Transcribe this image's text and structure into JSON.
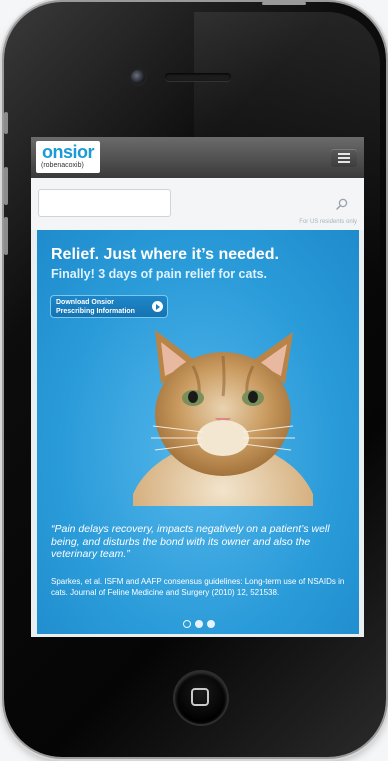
{
  "header": {
    "logo_word": "onsior",
    "logo_sub": "(robenacoxib)"
  },
  "search": {
    "value": "",
    "placeholder": "",
    "us_note": "For US residents only"
  },
  "hero": {
    "headline": "Relief. Just where it’s needed.",
    "subhead": "Finally! 3 days of pain relief for cats.",
    "download_line1": "Download Onsior",
    "download_line2": "Prescribing Information",
    "quote": "“Pain delays recovery, impacts negatively on a patient’s well being, and disturbs the bond with its owner and also the veterinary team.”",
    "citation": "Sparkes, et al. ISFM and AAFP consensus guidelines: Long-term use of NSAIDs in cats. Journal of Feline Medicine and Surgery (2010) 12, 521538."
  },
  "carousel": {
    "active_index": 0,
    "count": 3
  },
  "colors": {
    "brand": "#1c9ad6",
    "hero_bg": "#2a9bd9",
    "header_bg": "#4a4a4a"
  }
}
